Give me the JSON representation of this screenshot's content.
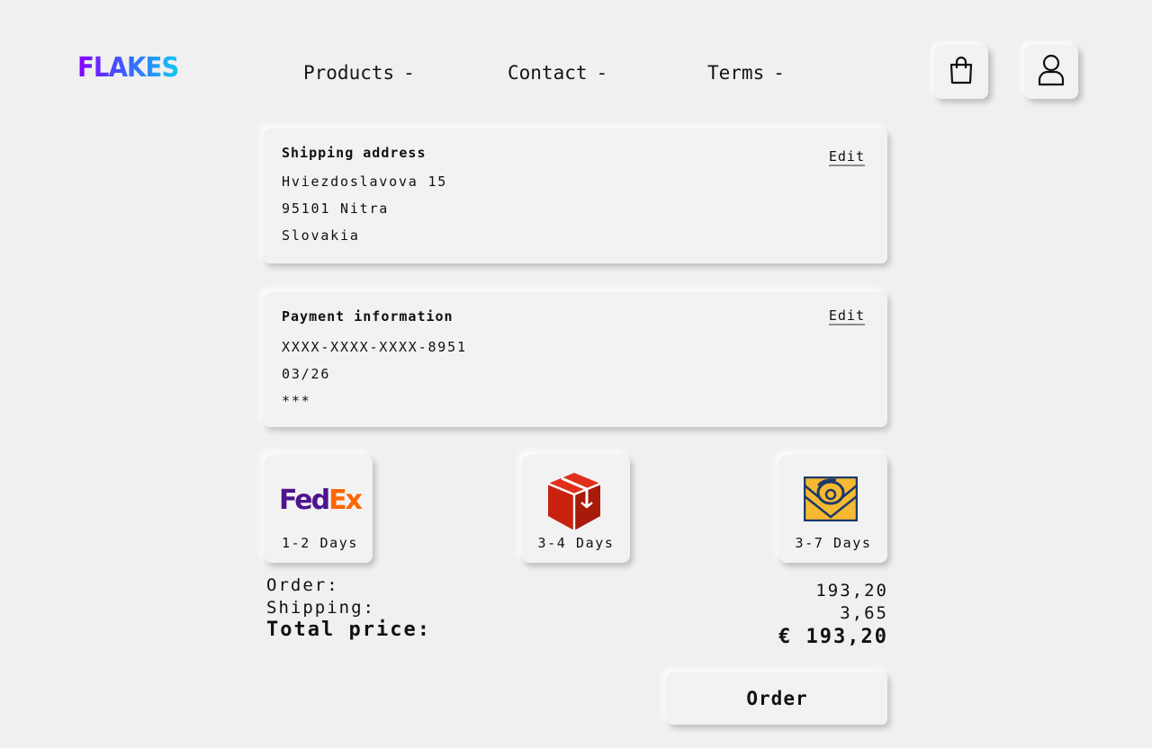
{
  "brand": {
    "name": "FLAKES",
    "gradient": [
      "#8a00ff",
      "#3d5bff",
      "#13c8f0"
    ]
  },
  "nav": {
    "items": [
      {
        "label": "Products",
        "chevron": "-"
      },
      {
        "label": "Contact",
        "chevron": "-"
      },
      {
        "label": "Terms",
        "chevron": "-"
      }
    ]
  },
  "header_icons": {
    "cart": "shopping-bag-icon",
    "account": "user-icon"
  },
  "shipping_address": {
    "title": "Shipping address",
    "edit_label": "Edit",
    "lines": [
      "Hviezdoslavova 15",
      "95101 Nitra",
      "Slovakia"
    ]
  },
  "payment_information": {
    "title": "Payment information",
    "edit_label": "Edit",
    "lines": [
      "XXXX-XXXX-XXXX-8951",
      "03/26",
      "***"
    ]
  },
  "shipping_options": [
    {
      "carrier": "FedEx",
      "logo_parts": [
        "Fed",
        "Ex"
      ],
      "logo_colors": [
        "#4d148c",
        "#ff6600"
      ],
      "days": "1-2 Days"
    },
    {
      "carrier": "package-cube-logo",
      "logo_color": "#c8220f",
      "days": "3-4 Days"
    },
    {
      "carrier": "post-horn-logo",
      "logo_colors": [
        "#f7b932",
        "#1b3a6b"
      ],
      "days": "3-7 Days"
    }
  ],
  "summary": {
    "order_label": "Order:",
    "order_value": "193,20",
    "shipping_label": "Shipping:",
    "shipping_value": "3,65",
    "total_label": "Total price:",
    "total_value": "€ 193,20"
  },
  "order_button": {
    "label": "Order"
  }
}
